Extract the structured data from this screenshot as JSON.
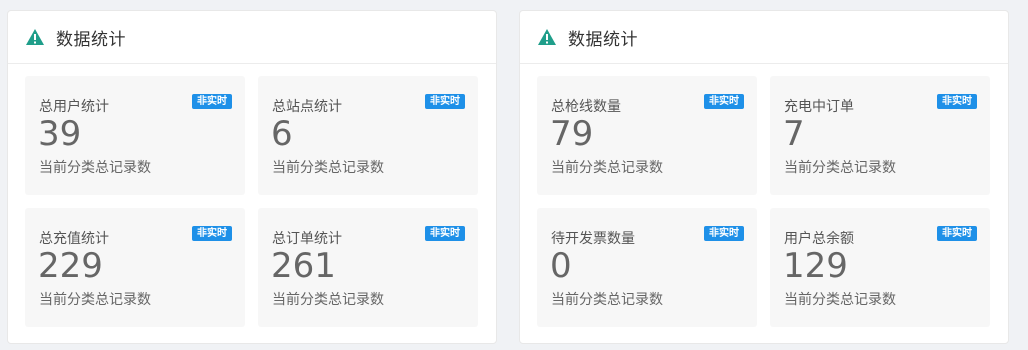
{
  "panels": [
    {
      "title": "数据统计",
      "cards": [
        {
          "label": "总用户统计",
          "badge": "非实时",
          "value": "39",
          "desc": "当前分类总记录数"
        },
        {
          "label": "总站点统计",
          "badge": "非实时",
          "value": "6",
          "desc": "当前分类总记录数"
        },
        {
          "label": "总充值统计",
          "badge": "非实时",
          "value": "229",
          "desc": "当前分类总记录数"
        },
        {
          "label": "总订单统计",
          "badge": "非实时",
          "value": "261",
          "desc": "当前分类总记录数"
        }
      ]
    },
    {
      "title": "数据统计",
      "cards": [
        {
          "label": "总枪线数量",
          "badge": "非实时",
          "value": "79",
          "desc": "当前分类总记录数"
        },
        {
          "label": "充电中订单",
          "badge": "非实时",
          "value": "7",
          "desc": "当前分类总记录数"
        },
        {
          "label": "待开发票数量",
          "badge": "非实时",
          "value": "0",
          "desc": "当前分类总记录数"
        },
        {
          "label": "用户总余额",
          "badge": "非实时",
          "value": "129",
          "desc": "当前分类总记录数"
        }
      ]
    }
  ],
  "icons": {
    "header": "warning-triangle-icon"
  },
  "colors": {
    "icon": "#1f9e8a",
    "badge": "#1e90e8",
    "card_bg": "#f7f7f7"
  }
}
